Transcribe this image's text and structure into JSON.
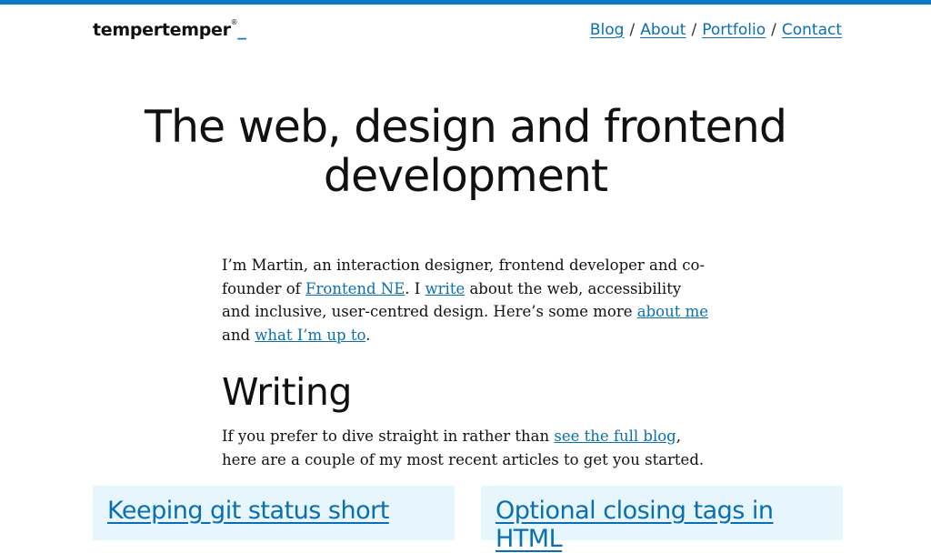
{
  "header": {
    "logo_text": "tempertemper",
    "logo_reg": "®",
    "logo_cursor": "_",
    "nav": [
      {
        "label": "Blog"
      },
      {
        "label": "About"
      },
      {
        "label": "Portfolio"
      },
      {
        "label": "Contact"
      }
    ],
    "nav_separator": "/"
  },
  "hero": {
    "line1": "The web, design and frontend",
    "line2": "development"
  },
  "intro": {
    "text1": "I’m Martin, an interaction designer, frontend developer and co-founder of ",
    "link1": "Frontend NE",
    "text2": ". I ",
    "link2": "write",
    "text3": " about the web, accessibility and inclusive, user-centred design. Here’s some more ",
    "link3": "about me",
    "text4": " and ",
    "link4": "what I’m up to",
    "text5": "."
  },
  "writing": {
    "title": "Writing",
    "text1": "If you prefer to dive straight in rather than ",
    "link1": "see the full blog",
    "text2": ", here are a couple of my most recent articles to get you started.",
    "articles": [
      {
        "title": "Keeping git status short"
      },
      {
        "title": "Optional closing tags in HTML"
      }
    ]
  },
  "colors": {
    "accent": "#0a7bc2",
    "link": "#0a6fb0",
    "card_bg": "#e7f5fc"
  }
}
